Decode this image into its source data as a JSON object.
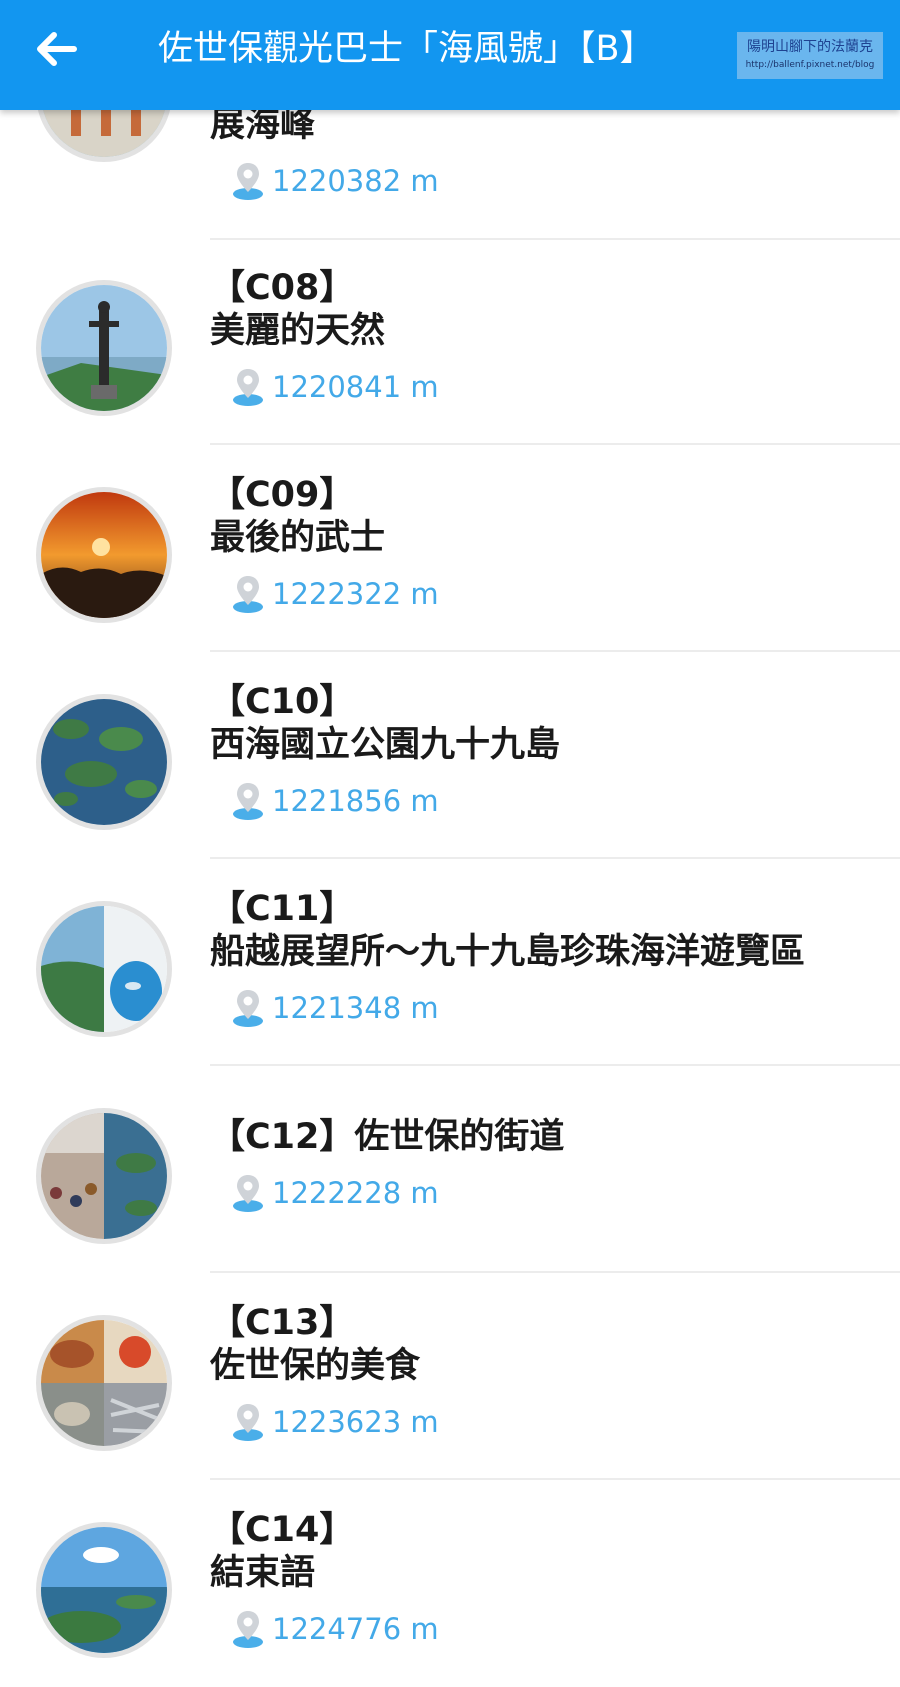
{
  "header": {
    "title": "佐世保觀光巴士「海風號」【B】",
    "watermark_line1": "陽明山腳下的法蘭克",
    "watermark_line2": "http://ballenf.pixnet.net/blog"
  },
  "colors": {
    "app_bar": "#1296f0",
    "distance_text": "#43a9e8",
    "title_text": "#1a1a1a"
  },
  "icons": {
    "back": "arrow-left-icon",
    "location": "location-pin-icon"
  },
  "items": [
    {
      "code": "",
      "name": "展海峰",
      "distance": "1220382 m"
    },
    {
      "code": "【C08】",
      "name": "美麗的天然",
      "distance": "1220841 m"
    },
    {
      "code": "【C09】",
      "name": "最後的武士",
      "distance": "1222322 m"
    },
    {
      "code": "【C10】",
      "name": "西海國立公園九十九島",
      "distance": "1221856 m"
    },
    {
      "code": "【C11】",
      "name": "船越展望所～九十九島珍珠海洋遊覽區",
      "distance": "1221348 m"
    },
    {
      "code": "",
      "name": "【C12】佐世保的街道",
      "distance": "1222228 m"
    },
    {
      "code": "【C13】",
      "name": "佐世保的美食",
      "distance": "1223623 m"
    },
    {
      "code": "【C14】",
      "name": "結束語",
      "distance": "1224776 m"
    }
  ]
}
